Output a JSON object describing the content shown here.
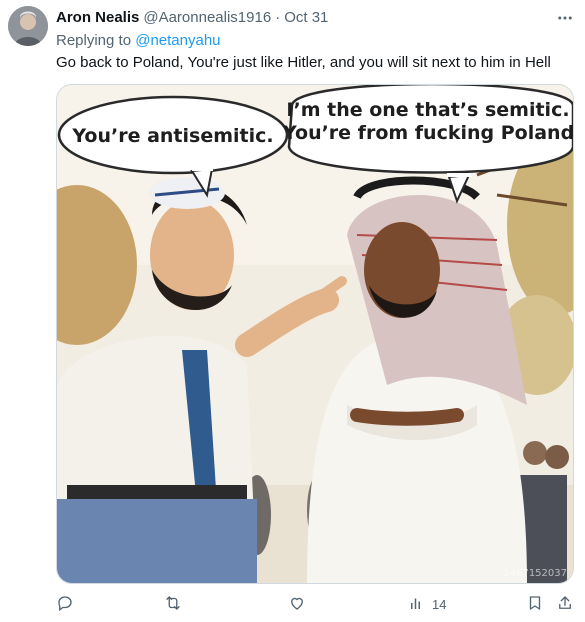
{
  "tweet": {
    "author_name": "Aron Nealis",
    "author_handle": "@Aaronnealis1916",
    "separator": "·",
    "date": "Oct 31",
    "replying_prefix": "Replying to ",
    "replying_to": "@netanyahu",
    "text": "Go back to Poland, You're just like Hitler, and you will sit next to him in Hell"
  },
  "media": {
    "bubble_left": "You’re antisemitic.",
    "bubble_right_line1": "I’m the one that’s semitic.",
    "bubble_right_line2": "You’re from fucking Poland",
    "watermark": "2467152037"
  },
  "actions": {
    "views_count": "14"
  },
  "icons": {
    "more": "more-icon",
    "reply": "reply-icon",
    "retweet": "retweet-icon",
    "like": "like-icon",
    "views": "views-icon",
    "bookmark": "bookmark-icon",
    "share": "share-icon"
  },
  "colors": {
    "link": "#1d9bf0",
    "secondary_text": "#536471",
    "primary_text": "#0f1419",
    "border": "#cfd9de"
  }
}
